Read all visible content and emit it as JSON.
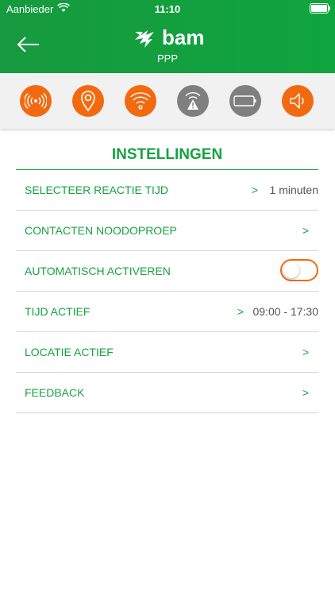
{
  "status": {
    "carrier": "Aanbieder",
    "time": "11:10"
  },
  "header": {
    "brand": "bam",
    "subtitle": "PPP"
  },
  "status_icons": [
    {
      "name": "alarm-broadcast-icon",
      "color": "#f26a10"
    },
    {
      "name": "location-pin-icon",
      "color": "#f26a10"
    },
    {
      "name": "wifi-icon",
      "color": "#f26a10"
    },
    {
      "name": "no-signal-warning-icon",
      "color": "#7f7f7f"
    },
    {
      "name": "battery-icon",
      "color": "#7f7f7f"
    },
    {
      "name": "speaker-icon",
      "color": "#f26a10"
    }
  ],
  "settings": {
    "title": "INSTELLINGEN",
    "rows": [
      {
        "label": "SELECTEER REACTIE TIJD",
        "value": "1 minuten"
      },
      {
        "label": "CONTACTEN NOODOPROEP",
        "value": ""
      },
      {
        "label": "AUTOMATISCH ACTIVEREN",
        "toggle": false
      },
      {
        "label": "TIJD ACTIEF",
        "value": "09:00 - 17:30"
      },
      {
        "label": "LOCATIE ACTIEF",
        "value": ""
      },
      {
        "label": "FEEDBACK",
        "value": ""
      }
    ],
    "chevron": ">"
  },
  "colors": {
    "brand_green": "#16a33f",
    "accent_orange": "#f26a10",
    "inactive_grey": "#7f7f7f"
  }
}
